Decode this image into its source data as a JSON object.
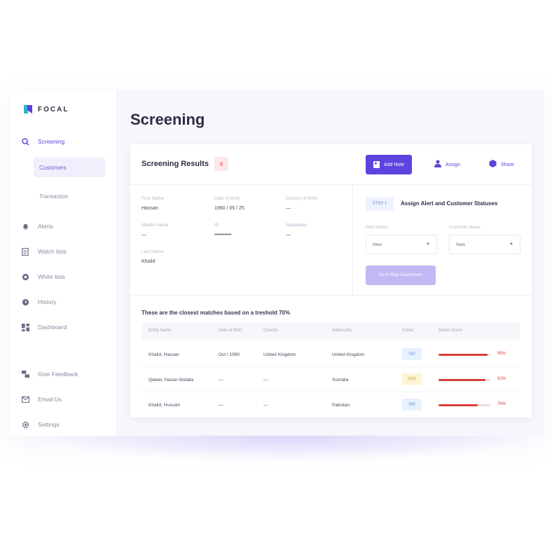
{
  "brand": {
    "name": "FOCAL"
  },
  "sidebar": {
    "screening": {
      "label": "Screening",
      "icon": "search-icon"
    },
    "sub_items": [
      {
        "label": "Customers",
        "active": true
      },
      {
        "label": "Transaction",
        "active": false
      }
    ],
    "items": [
      {
        "label": "Alerts",
        "icon": "bell-icon"
      },
      {
        "label": "Watch lists",
        "icon": "document-icon"
      },
      {
        "label": "White lists",
        "icon": "globe-icon"
      },
      {
        "label": "History",
        "icon": "clock-icon"
      },
      {
        "label": "Dashboard",
        "icon": "dashboard-icon"
      }
    ],
    "bottom_items": [
      {
        "label": "Give Feedback",
        "icon": "feedback-icon"
      },
      {
        "label": "Email Us",
        "icon": "mail-icon"
      },
      {
        "label": "Settings",
        "icon": "gear-icon"
      }
    ]
  },
  "page": {
    "title": "Screening"
  },
  "results": {
    "title": "Screening Results",
    "count": "6",
    "add_note": "Add Note",
    "assign": "Assign",
    "share": "Share"
  },
  "details": [
    {
      "label": "First Name",
      "value": "Hassan"
    },
    {
      "label": "Date of Birth",
      "value": "1960 / 05 / 25"
    },
    {
      "label": "Country of Birth",
      "value": "—"
    },
    {
      "label": "Middle Name",
      "value": "—"
    },
    {
      "label": "ID",
      "value": "••••••••••"
    },
    {
      "label": "Nationality",
      "value": "—"
    },
    {
      "label": "Last Name",
      "value": "Khalid"
    }
  ],
  "step": {
    "badge": "STEP 1",
    "title": "Assign Alert and Customer Statuses",
    "alert_status_label": "Alert Status",
    "alert_status_value": "New",
    "customer_status_label": "Customer Status",
    "customer_status_value": "New",
    "button": "Go to Risk Assessment"
  },
  "matches": {
    "title": "These are the closest matches based on a treshold 70%",
    "columns": [
      "Entity Name",
      "Date of Birth",
      "Country",
      "Nationality",
      "Crime",
      "Match Score"
    ],
    "rows": [
      {
        "name": "Khalid, Hassan",
        "dob": "Oct / 1990",
        "country": "United Kingdom",
        "nationality": "United Kingdom",
        "crime": "SIP",
        "score": 95,
        "score_label": "95%",
        "tag_bg": "#e6f1ff",
        "tag_color": "#6f8fd0"
      },
      {
        "name": "Qaleel, Hasan Abdalla",
        "dob": "—",
        "country": "—",
        "nationality": "Somalia",
        "crime": "PEP",
        "score": 91,
        "score_label": "91%",
        "tag_bg": "#fff4d6",
        "tag_color": "#c8a232"
      },
      {
        "name": "Khalid, Hussain",
        "dob": "—",
        "country": "—",
        "nationality": "Pakistan",
        "crime": "SIP",
        "score": 76,
        "score_label": "76%",
        "tag_bg": "#e6f1ff",
        "tag_color": "#6f8fd0"
      }
    ]
  }
}
